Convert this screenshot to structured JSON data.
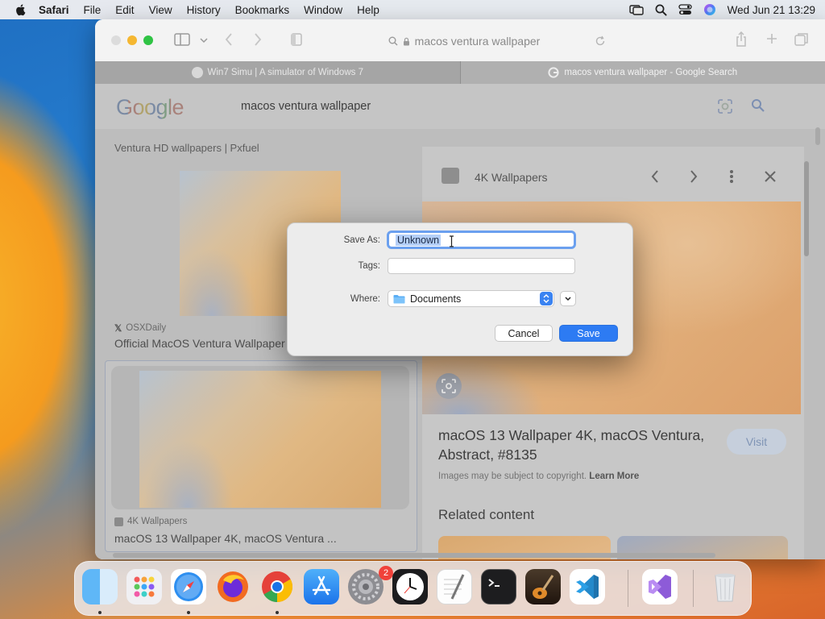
{
  "menubar": {
    "app": "Safari",
    "items": [
      "File",
      "Edit",
      "View",
      "History",
      "Bookmarks",
      "Window",
      "Help"
    ],
    "clock": "Wed Jun 21  13:29"
  },
  "safari": {
    "address": "macos ventura wallpaper",
    "tabs": [
      {
        "label": "Win7 Simu | A simulator of Windows 7",
        "active": false
      },
      {
        "label": "macos ventura wallpaper - Google Search",
        "active": true
      }
    ]
  },
  "google": {
    "logo": "Google",
    "query": "macos ventura wallpaper",
    "top_caption": "Ventura HD wallpapers | Pxfuel",
    "results": [
      {
        "source": "OSXDaily",
        "title": "Official MacOS Ventura Wallpaper"
      },
      {
        "source": "4K Wallpapers",
        "title": "macOS 13 Wallpaper 4K, macOS Ventura ..."
      }
    ],
    "panel": {
      "source": "4K Wallpapers",
      "title": "macOS 13 Wallpaper 4K, macOS Ventura, Abstract, #8135",
      "visit": "Visit",
      "copyright": "Images may be subject to copyright.",
      "learn_more": "Learn More",
      "related": "Related content"
    }
  },
  "dialog": {
    "save_as_label": "Save As:",
    "save_as_value": "Unknown",
    "tags_label": "Tags:",
    "where_label": "Where:",
    "where_value": "Documents",
    "cancel": "Cancel",
    "save": "Save"
  },
  "dock": {
    "apps": [
      "Finder",
      "Launchpad",
      "Safari",
      "Firefox",
      "Chrome",
      "App Store",
      "System Settings",
      "Clock",
      "TextEdit",
      "Terminal",
      "GarageBand",
      "Visual Studio Code",
      "Visual Studio",
      "Trash"
    ],
    "settings_badge": "2"
  },
  "colors": {
    "accent": "#2d7bf3",
    "badge": "#f0413a"
  }
}
